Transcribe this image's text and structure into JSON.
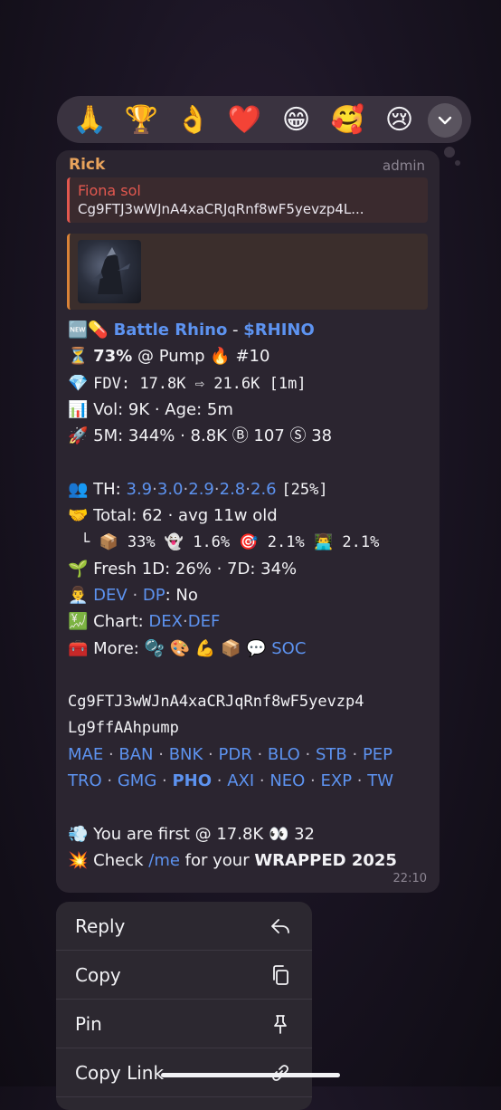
{
  "reactions": [
    "🙏",
    "🏆",
    "👌",
    "❤️",
    "😁",
    "🥰",
    "😢"
  ],
  "message": {
    "sender": "Rick",
    "role": "admin",
    "reply_to_name": "Fiona sol",
    "reply_to_text": "Cg9FTJ3wWJnA4xaCRJqRnf8wF5yevzp4L...",
    "timestamp": "22:10",
    "lines": {
      "l1_emoji": "🆕💊",
      "l1_name": "Battle Rhino",
      "l1_sep": " - ",
      "l1_ticker": "$RHINO",
      "l2_emoji": "⏳",
      "l2_pct": "73%",
      "l2_rest": "@ Pump 🔥 #10",
      "l3_emoji": "💎",
      "l3_text": "FDV: 17.8K ⇨ 21.6K [1m]",
      "l4_emoji": "📊",
      "l4_text": "Vol: 9K · Age: 5m",
      "l5_emoji": "🚀",
      "l5_text": "5M: 344% · 8.8K Ⓑ 107 Ⓢ 38",
      "l6_emoji": "👥",
      "l6_label": "TH:",
      "l6_vals": [
        "3.9",
        "3.0",
        "2.9",
        "2.8",
        "2.6"
      ],
      "l6_tail": "[25%]",
      "l7_emoji": "🤝",
      "l7_text": "Total: 62 · avg 11w old",
      "l8_text": "└ 📦 33% 👻 1.6% 🎯 2.1% 👨‍💻 2.1%",
      "l9_emoji": "🌱",
      "l9_text": "Fresh 1D: 26% · 7D: 34%",
      "l10_emoji": "👨‍💼",
      "l10_link1": "DEV",
      "l10_link2": "DP",
      "l10_tail": ": No",
      "l11_emoji": "💹",
      "l11_label": "Chart:",
      "l11_link1": "DEX",
      "l11_link2": "DEF",
      "l12_emoji": "🧰",
      "l12_label": "More: 🫧 🎨 💪 📦 💬",
      "l12_link": "SOC",
      "address_line1": "Cg9FTJ3wWJnA4xaCRJqRnf8wF5yevzp4",
      "address_line2": "Lg9ffAAhpump",
      "links_row1": [
        "MAE",
        "BAN",
        "BNK",
        "PDR",
        "BLO",
        "STB",
        "PEP"
      ],
      "links_row2": [
        "TRO",
        "GMG",
        "PHO",
        "AXI",
        "NEO",
        "EXP",
        "TW"
      ],
      "l15_emoji": "💨",
      "l15_text": "You are first @ 17.8K 👀 32",
      "l16_emoji": "💥",
      "l16_pre": "Check ",
      "l16_link": "/me",
      "l16_mid": " for your ",
      "l16_bold": "WRAPPED 2025"
    }
  },
  "menu": {
    "reply": "Reply",
    "copy": "Copy",
    "pin": "Pin",
    "copy_link": "Copy Link"
  }
}
